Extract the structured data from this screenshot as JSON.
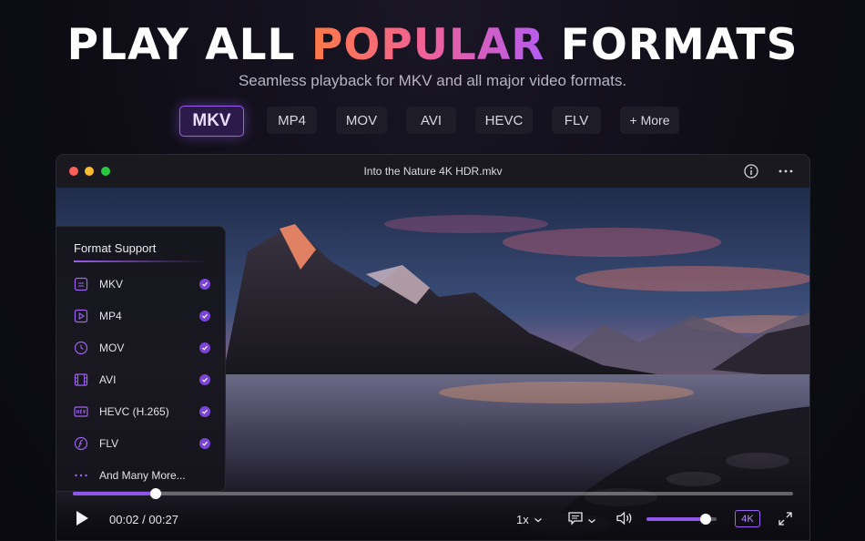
{
  "hero": {
    "title_prefix": "PLAY ALL ",
    "title_highlight": "POPULAR",
    "title_suffix": " FORMATS",
    "subtitle": "Seamless playback for MKV and all major video formats."
  },
  "format_chips": [
    "MKV",
    "MP4",
    "MOV",
    "AVI",
    "HEVC",
    "FLV",
    "+ More"
  ],
  "active_chip": "MKV",
  "window": {
    "title": "Into the Nature 4K HDR.mkv",
    "traffic_lights": [
      "#ff5f57",
      "#febc2e",
      "#28c840"
    ]
  },
  "sidebar": {
    "title": "Format Support",
    "items": [
      {
        "label": "MKV",
        "icon": "mkv-file-icon",
        "supported": true
      },
      {
        "label": "MP4",
        "icon": "play-file-icon",
        "supported": true
      },
      {
        "label": "MOV",
        "icon": "clock-circle-icon",
        "supported": true
      },
      {
        "label": "AVI",
        "icon": "film-strip-icon",
        "supported": true
      },
      {
        "label": "HEVC (H.265)",
        "icon": "hevc-icon",
        "supported": true
      },
      {
        "label": "FLV",
        "icon": "flash-icon",
        "supported": true
      },
      {
        "label": "And Many More...",
        "icon": "dots-icon",
        "supported": false
      }
    ]
  },
  "player": {
    "current_time": "00:02",
    "duration": "00:27",
    "time_separator": " / ",
    "progress_fraction": 0.115,
    "speed": "1x",
    "volume_fraction": 0.84,
    "quality_badge": "4K"
  },
  "colors": {
    "accent": "#8f55ec",
    "accent_light": "#b990ff",
    "background": "#0d0c14"
  }
}
